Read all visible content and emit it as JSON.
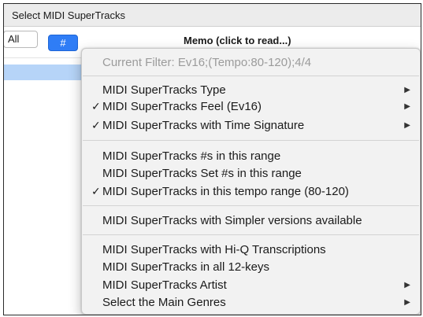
{
  "window": {
    "title": "Select MIDI SuperTracks"
  },
  "toolbar": {
    "all_label": "All",
    "hash_label": "#",
    "memo_header": "Memo (click to read...)"
  },
  "menu": {
    "filter_label": "Current Filter: Ev16;(Tempo:80-120);4/4",
    "check_glyph": "✓",
    "arrow_glyph": "▶",
    "items": [
      {
        "label": "MIDI SuperTracks Type",
        "checked": false,
        "submenu": true
      },
      {
        "label": "MIDI SuperTracks Feel  (Ev16)",
        "checked": true,
        "submenu": true
      },
      {
        "label": "MIDI SuperTracks with Time Signature",
        "checked": true,
        "submenu": true
      },
      {
        "label": "MIDI SuperTracks #s in this range",
        "checked": false,
        "submenu": false
      },
      {
        "label": "MIDI SuperTracks Set #s in this range",
        "checked": false,
        "submenu": false
      },
      {
        "label": "MIDI SuperTracks in this tempo range   (80-120)",
        "checked": true,
        "submenu": false
      },
      {
        "label": "MIDI SuperTracks with Simpler versions available",
        "checked": false,
        "submenu": false
      },
      {
        "label": "MIDI SuperTracks with Hi-Q Transcriptions",
        "checked": false,
        "submenu": false
      },
      {
        "label": "MIDI SuperTracks in all 12-keys",
        "checked": false,
        "submenu": false
      },
      {
        "label": "MIDI SuperTracks Artist",
        "checked": false,
        "submenu": true
      },
      {
        "label": "Select the Main Genres",
        "checked": false,
        "submenu": true
      }
    ]
  }
}
